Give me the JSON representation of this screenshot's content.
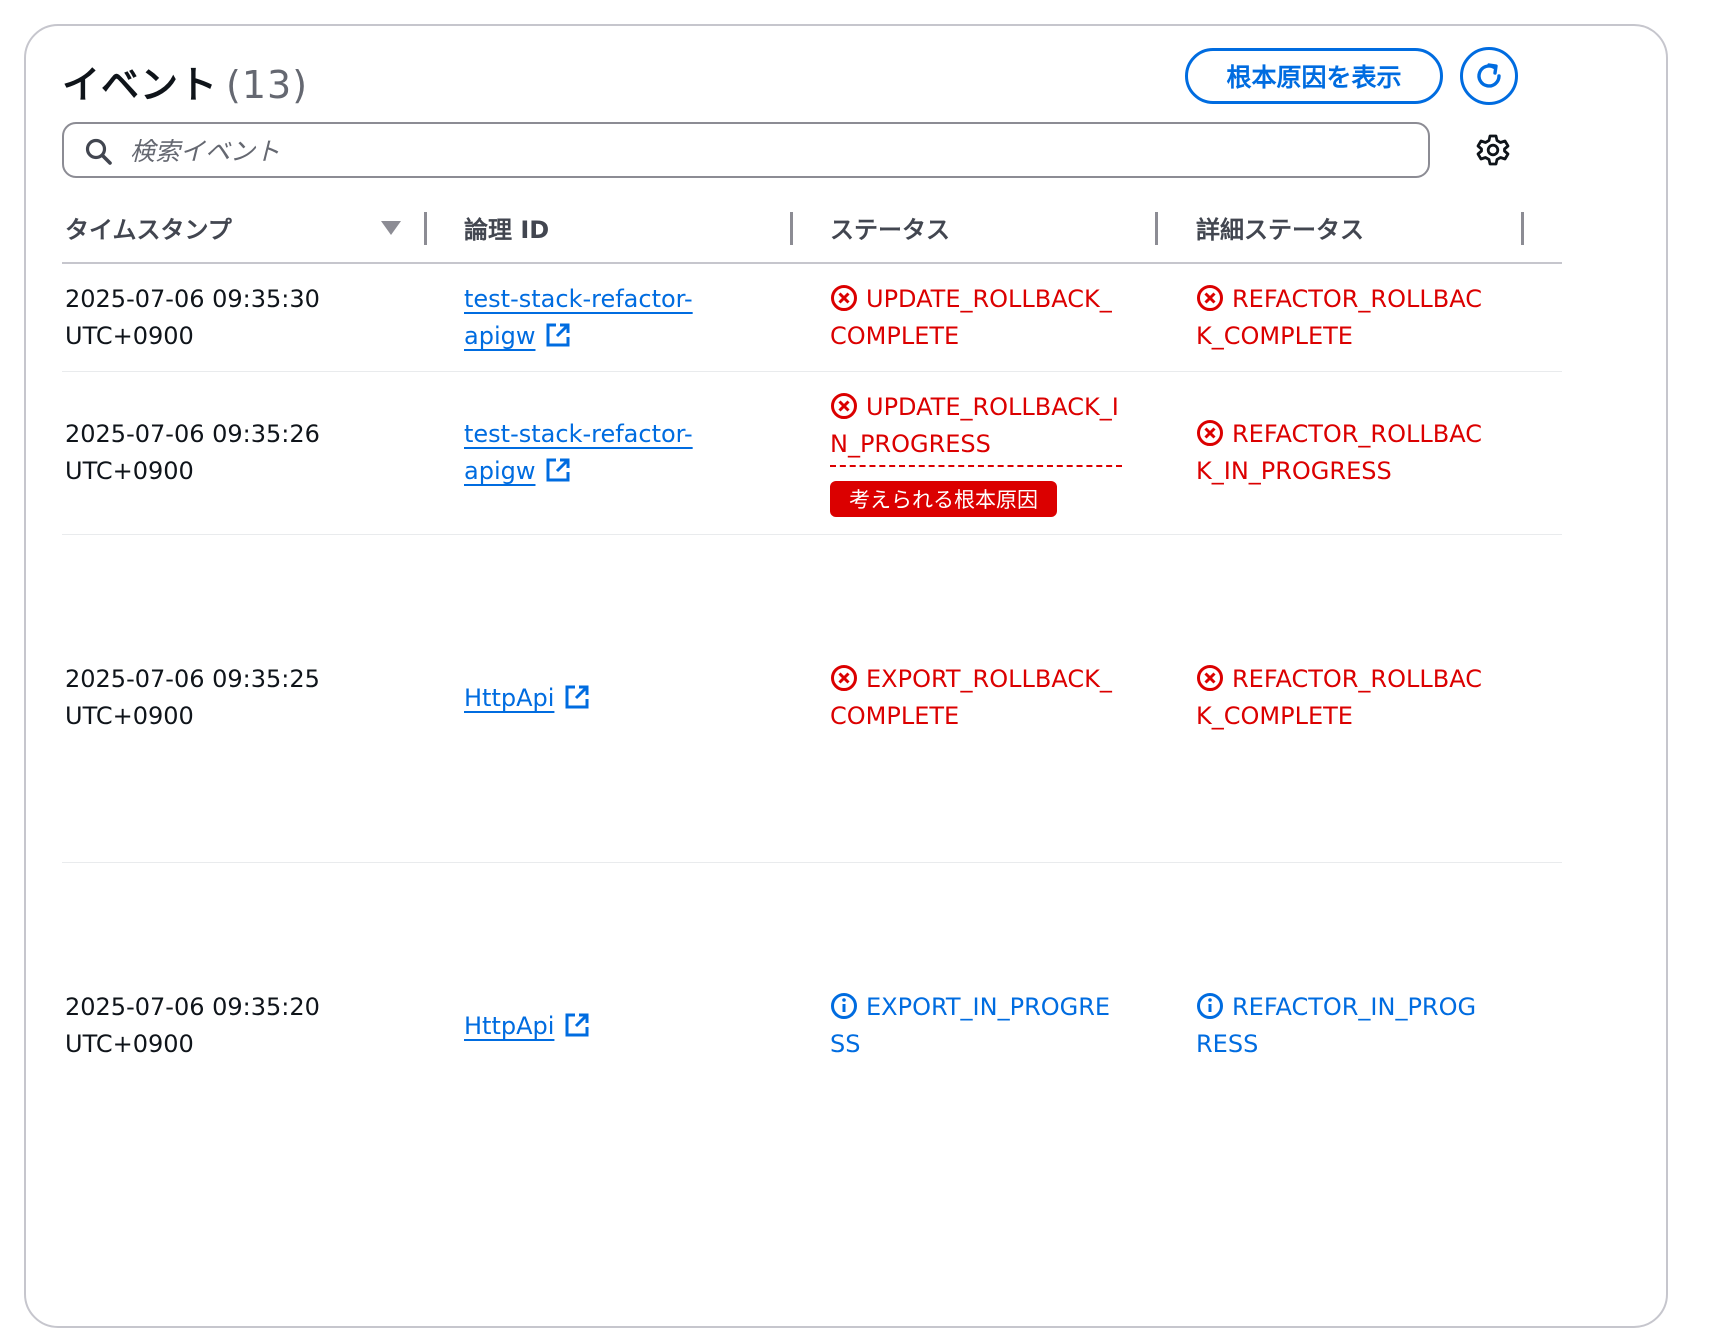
{
  "header": {
    "title": "イベント",
    "count": "(13)",
    "root_cause_button": "根本原因を表示"
  },
  "search": {
    "placeholder": "検索イベント",
    "value": ""
  },
  "columns": [
    "タイムスタンプ",
    "論理 ID",
    "ステータス",
    "詳細ステータス"
  ],
  "rows": [
    {
      "ts_line1": "2025-07-06 09:35:30",
      "ts_line2": "UTC+0900",
      "id_line1": "test-stack-refactor-",
      "id_line2": "apigw",
      "status_line1": "UPDATE_ROLLBACK_",
      "status_line2": "COMPLETE",
      "detail_line1": "REFACTOR_ROLLBAC",
      "detail_line2": "K_COMPLETE"
    },
    {
      "ts_line1": "2025-07-06 09:35:26",
      "ts_line2": "UTC+0900",
      "id_line1": "test-stack-refactor-",
      "id_line2": "apigw",
      "status_line1": "UPDATE_ROLLBACK_I",
      "status_line2": "N_PROGRESS",
      "badge": "考えられる根本原因",
      "detail_line1": "REFACTOR_ROLLBAC",
      "detail_line2": "K_IN_PROGRESS"
    },
    {
      "ts_line1": "2025-07-06 09:35:25",
      "ts_line2": "UTC+0900",
      "id_line1": "HttpApi",
      "status_line1": "EXPORT_ROLLBACK_",
      "status_line2": "COMPLETE",
      "detail_line1": "REFACTOR_ROLLBAC",
      "detail_line2": "K_COMPLETE"
    },
    {
      "ts_line1": "2025-07-06 09:35:20",
      "ts_line2": "UTC+0900",
      "id_line1": "HttpApi",
      "status_line1": "EXPORT_IN_PROGRE",
      "status_line2": "SS",
      "detail_line1": "REFACTOR_IN_PROG",
      "detail_line2": "RESS"
    }
  ],
  "colors": {
    "error": "#db0000",
    "info": "#006ce0",
    "link": "#006ce0"
  },
  "icons": {
    "error": "x-circle-icon",
    "info": "info-circle-icon",
    "external": "external-link-icon",
    "refresh": "refresh-icon",
    "settings": "gear-icon",
    "search": "search-icon",
    "sort": "sort-down-icon"
  }
}
